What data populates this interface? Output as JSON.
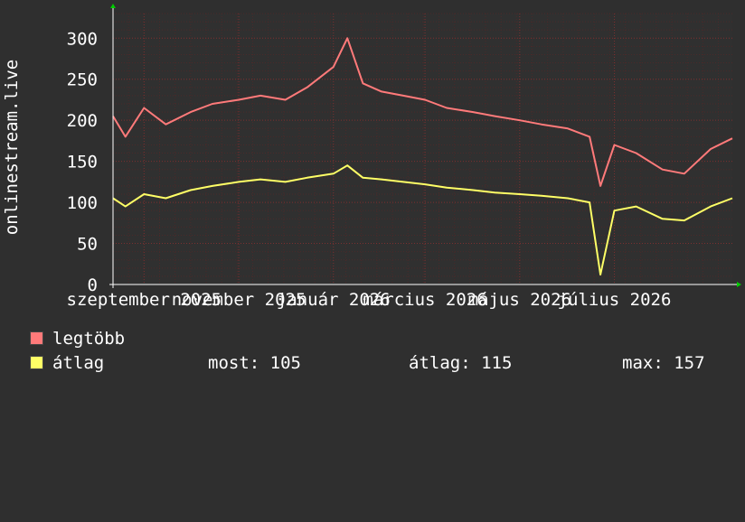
{
  "chart_data": {
    "type": "line",
    "ylabel": "onlinestream.live",
    "ylim": [
      0,
      330
    ],
    "yticks": [
      0,
      50,
      100,
      150,
      200,
      250,
      300
    ],
    "grid": true,
    "x_start": "2025-08-12",
    "x_end": "2026-09-15",
    "xtick_labels": [
      {
        "date": "2025-09-01",
        "label": "szeptember 2025"
      },
      {
        "date": "2025-11-01",
        "label": "november 2025"
      },
      {
        "date": "2026-01-01",
        "label": "január 2026"
      },
      {
        "date": "2026-03-01",
        "label": "március 2026"
      },
      {
        "date": "2026-05-01",
        "label": "május 2026"
      },
      {
        "date": "2026-07-01",
        "label": "július 2026"
      }
    ],
    "series": [
      {
        "name": "legtöbb",
        "color": "#ff7a7a",
        "points": [
          [
            "2025-08-12",
            205
          ],
          [
            "2025-08-20",
            180
          ],
          [
            "2025-09-01",
            215
          ],
          [
            "2025-09-15",
            195
          ],
          [
            "2025-10-01",
            210
          ],
          [
            "2025-10-15",
            220
          ],
          [
            "2025-11-01",
            225
          ],
          [
            "2025-11-15",
            230
          ],
          [
            "2025-12-01",
            225
          ],
          [
            "2025-12-15",
            240
          ],
          [
            "2026-01-01",
            265
          ],
          [
            "2026-01-10",
            300
          ],
          [
            "2026-01-20",
            245
          ],
          [
            "2026-02-01",
            235
          ],
          [
            "2026-02-15",
            230
          ],
          [
            "2026-03-01",
            225
          ],
          [
            "2026-03-15",
            215
          ],
          [
            "2026-04-01",
            210
          ],
          [
            "2026-04-15",
            205
          ],
          [
            "2026-05-01",
            200
          ],
          [
            "2026-05-15",
            195
          ],
          [
            "2026-06-01",
            190
          ],
          [
            "2026-06-15",
            180
          ],
          [
            "2026-06-22",
            120
          ],
          [
            "2026-07-01",
            170
          ],
          [
            "2026-07-15",
            160
          ],
          [
            "2026-08-01",
            140
          ],
          [
            "2026-08-15",
            135
          ],
          [
            "2026-09-01",
            165
          ],
          [
            "2026-09-15",
            178
          ]
        ]
      },
      {
        "name": "átlag",
        "color": "#ffff66",
        "points": [
          [
            "2025-08-12",
            105
          ],
          [
            "2025-08-20",
            95
          ],
          [
            "2025-09-01",
            110
          ],
          [
            "2025-09-15",
            105
          ],
          [
            "2025-10-01",
            115
          ],
          [
            "2025-10-15",
            120
          ],
          [
            "2025-11-01",
            125
          ],
          [
            "2025-11-15",
            128
          ],
          [
            "2025-12-01",
            125
          ],
          [
            "2025-12-15",
            130
          ],
          [
            "2026-01-01",
            135
          ],
          [
            "2026-01-10",
            145
          ],
          [
            "2026-01-20",
            130
          ],
          [
            "2026-02-01",
            128
          ],
          [
            "2026-02-15",
            125
          ],
          [
            "2026-03-01",
            122
          ],
          [
            "2026-03-15",
            118
          ],
          [
            "2026-04-01",
            115
          ],
          [
            "2026-04-15",
            112
          ],
          [
            "2026-05-01",
            110
          ],
          [
            "2026-05-15",
            108
          ],
          [
            "2026-06-01",
            105
          ],
          [
            "2026-06-15",
            100
          ],
          [
            "2026-06-22",
            12
          ],
          [
            "2026-07-01",
            90
          ],
          [
            "2026-07-15",
            95
          ],
          [
            "2026-08-01",
            80
          ],
          [
            "2026-08-15",
            78
          ],
          [
            "2026-09-01",
            95
          ],
          [
            "2026-09-15",
            105
          ]
        ]
      }
    ]
  },
  "legend": {
    "max_label": "legtöbb",
    "avg_label": "átlag",
    "stats": {
      "most": "most: 105",
      "atlag": "átlag: 115",
      "max": "max: 157"
    }
  },
  "colors": {
    "background": "#2f2f2f",
    "plot_background": "#303030",
    "grid_minor": "#4a2a2a",
    "grid_major": "#7a3030",
    "axis": "#ffffff",
    "arrow": "#00cc00"
  }
}
